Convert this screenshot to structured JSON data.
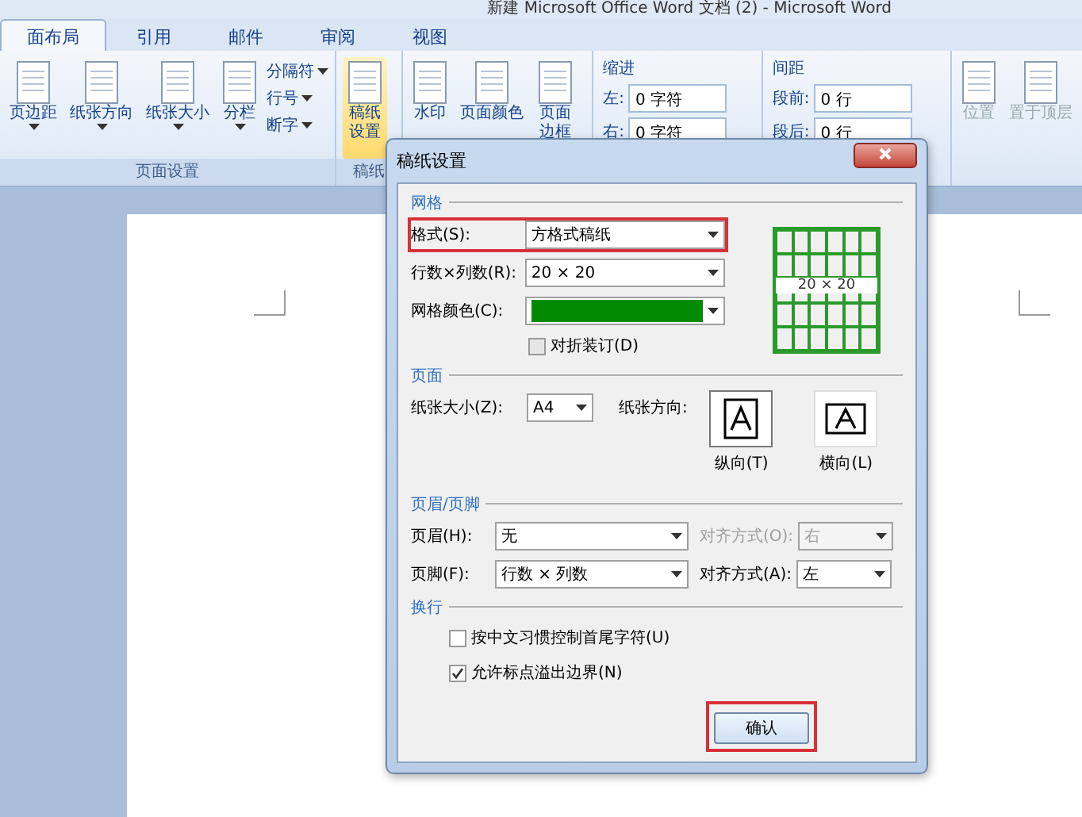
{
  "window": {
    "title": "新建 Microsoft Office Word 文档 (2) - Microsoft Word"
  },
  "tabs": [
    {
      "label": "面布局",
      "selected": true
    },
    {
      "label": "引用",
      "selected": false
    },
    {
      "label": "邮件",
      "selected": false
    },
    {
      "label": "审阅",
      "selected": false
    },
    {
      "label": "视图",
      "selected": false
    }
  ],
  "ribbon": {
    "page_setup": {
      "buttons": [
        {
          "label": "页边距"
        },
        {
          "label": "纸张方向"
        },
        {
          "label": "纸张大小"
        },
        {
          "label": "分栏"
        }
      ],
      "small_buttons": [
        {
          "label": "分隔符"
        },
        {
          "label": "行号"
        },
        {
          "label": "断字"
        }
      ],
      "label": "页面设置"
    },
    "manuscript": {
      "button": {
        "label": "稿纸设置",
        "selected": true
      },
      "label": "稿纸"
    },
    "background": {
      "buttons": [
        {
          "label": "水印"
        },
        {
          "label": "页面颜色"
        },
        {
          "label": "页面边框"
        }
      ]
    },
    "indent": {
      "title": "缩进",
      "fields": [
        {
          "label": "左:",
          "value": "0 字符"
        },
        {
          "label": "右:",
          "value": "0 字符"
        }
      ]
    },
    "spacing": {
      "title": "间距",
      "fields": [
        {
          "label": "段前:",
          "value": "0 行"
        },
        {
          "label": "段后:",
          "value": "0 行"
        }
      ]
    },
    "arrange": {
      "buttons": [
        {
          "label": "位置",
          "disabled": true
        },
        {
          "label": "置于顶层",
          "disabled": true
        }
      ]
    }
  },
  "dialog": {
    "title": "稿纸设置",
    "grid": {
      "title": "网格",
      "style": {
        "label": "格式(S):",
        "value": "方格式稿纸",
        "highlighted": true
      },
      "size": {
        "label": "行数×列数(R):",
        "value": "20 × 20"
      },
      "color": {
        "label": "网格颜色(C):",
        "color": "#008a00"
      },
      "fold": {
        "label": "对折装订(D)",
        "checked": false,
        "disabled": true
      },
      "preview": "20 × 20"
    },
    "page": {
      "title": "页面",
      "paper_size": {
        "label": "纸张大小(Z):",
        "value": "A4"
      },
      "orientation_label": "纸张方向:",
      "orientations": [
        {
          "label": "纵向(T)",
          "selected": true
        },
        {
          "label": "横向(L)",
          "selected": false
        }
      ]
    },
    "header_footer": {
      "title": "页眉/页脚",
      "rows": [
        {
          "label": "页眉(H):",
          "value": "无",
          "align_label": "对齐方式(O):",
          "align_value": "右",
          "align_disabled": true
        },
        {
          "label": "页脚(F):",
          "value": "行数 × 列数",
          "align_label": "对齐方式(A):",
          "align_value": "左",
          "align_disabled": false
        }
      ]
    },
    "wrap": {
      "title": "换行",
      "options": [
        {
          "label": "按中文习惯控制首尾字符(U)",
          "checked": false
        },
        {
          "label": "允许标点溢出边界(N)",
          "checked": true
        }
      ]
    },
    "ok": {
      "label": "确认",
      "highlighted": true
    }
  }
}
